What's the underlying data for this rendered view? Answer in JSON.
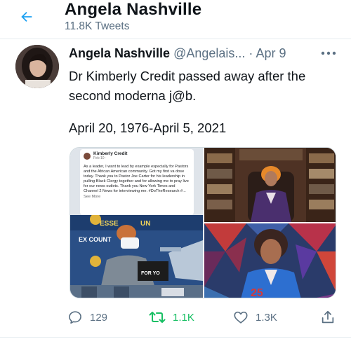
{
  "header": {
    "title": "Angela Nashville",
    "subtitle": "11.8K Tweets"
  },
  "tweet": {
    "display_name": "Angela Nashville",
    "handle": "@Angelais...",
    "separator": "·",
    "date": "Apr 9",
    "text": "Dr Kimberly Credit passed away after the second moderna j@b.",
    "dates_line": "April 20, 1976-April 5, 2021",
    "media": {
      "fb_post": {
        "name": "Kimberly Credit",
        "time": "Feb 10 · ",
        "body": "As a leader, I want to lead by example especially for Pastors and the African American community. Got my first va dose today. Thank you to Pastor Joe Carter for his leadership in pulling Black Clergy together and for allowing me to pray live for our news outlets. Thank you New York Times and Channel 2 News for interviewing me. #DoTheResearch #...",
        "see_more": "See More"
      }
    },
    "actions": {
      "reply_count": "129",
      "retweet_count": "1.1K",
      "like_count": "1.3K"
    }
  },
  "colors": {
    "accent": "#1da1f2",
    "secondary_text": "#5b7083",
    "retweet_green": "#17bf63",
    "divider": "#e6ecf0"
  }
}
